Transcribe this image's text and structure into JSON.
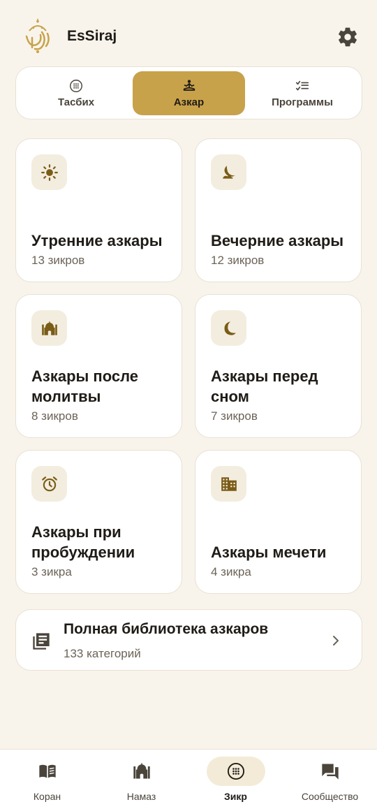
{
  "app": {
    "title": "EsSiraj"
  },
  "colors": {
    "accent": "#c8a24a",
    "icon": "#7a5c17",
    "background": "#f8f4ec"
  },
  "tabs": [
    {
      "label": "Тасбих",
      "icon": "tasbih-icon"
    },
    {
      "label": "Азкар",
      "icon": "meditation-icon",
      "selected": true
    },
    {
      "label": "Программы",
      "icon": "checklist-icon"
    }
  ],
  "cards": [
    {
      "title": "Утренние азкары",
      "subtitle": "13 зикров",
      "icon": "sun-icon"
    },
    {
      "title": "Вечерние азкары",
      "subtitle": "12 зикров",
      "icon": "night-icon"
    },
    {
      "title": "Азкары после молитвы",
      "subtitle": "8 зикров",
      "icon": "mosque-icon"
    },
    {
      "title": "Азкары перед сном",
      "subtitle": "7 зикров",
      "icon": "moon-icon"
    },
    {
      "title": "Азкары при пробуждении",
      "subtitle": "3 зикра",
      "icon": "alarm-icon"
    },
    {
      "title": "Азкары мечети",
      "subtitle": "4 зикра",
      "icon": "building-icon"
    }
  ],
  "library": {
    "title": "Полная библиотека азкаров",
    "subtitle": "133 категорий",
    "icon": "library-icon"
  },
  "bottom_nav": [
    {
      "label": "Коран",
      "icon": "book-icon"
    },
    {
      "label": "Намаз",
      "icon": "mosque-icon"
    },
    {
      "label": "Зикр",
      "icon": "tasbih-icon",
      "active": true
    },
    {
      "label": "Сообщество",
      "icon": "chat-icon"
    }
  ]
}
